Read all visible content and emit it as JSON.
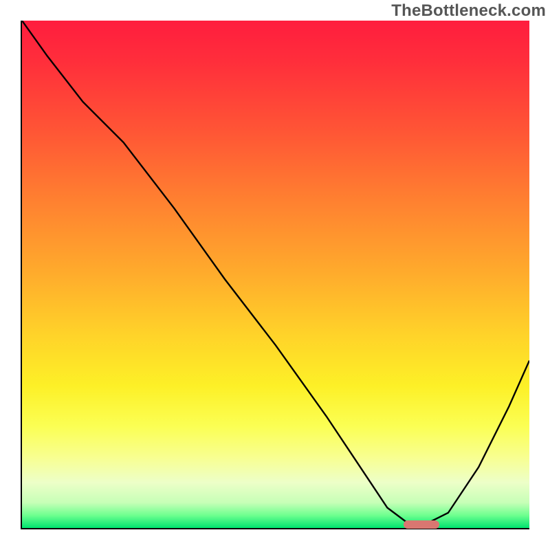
{
  "watermark": "TheBottleneck.com",
  "chart_data": {
    "type": "line",
    "title": "",
    "xlabel": "",
    "ylabel": "",
    "xlim": [
      0,
      100
    ],
    "ylim": [
      0,
      100
    ],
    "grid": false,
    "legend": false,
    "series": [
      {
        "name": "bottleneck-curve",
        "color": "#000000",
        "x": [
          0,
          5,
          12,
          20,
          30,
          40,
          50,
          60,
          68,
          72,
          76,
          80,
          84,
          90,
          96,
          100
        ],
        "y": [
          100,
          93,
          84,
          76,
          63,
          49,
          36,
          22,
          10,
          4,
          1,
          1,
          3,
          12,
          24,
          33
        ]
      }
    ],
    "marker": {
      "name": "optimal-zone",
      "color": "#d97771",
      "x_start": 75,
      "x_end": 82,
      "y": 1
    },
    "background_gradient": {
      "top": "#ff1d3e",
      "mid": "#ffd329",
      "bottom": "#00e36f"
    }
  }
}
